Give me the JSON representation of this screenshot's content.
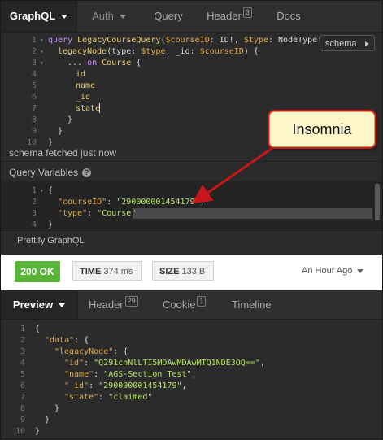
{
  "tabs": {
    "graphql": "GraphQL",
    "auth": "Auth",
    "query": "Query",
    "header": "Header",
    "header_count": "3",
    "docs": "Docs"
  },
  "editor": {
    "line_numbers": [
      "1",
      "2",
      "3",
      "4",
      "5",
      "6",
      "7",
      "8",
      "9",
      "10"
    ],
    "schema_button": "schema",
    "tokens": {
      "l1_kw": "query",
      "l1_name": "LegacyCourseQuery",
      "l1_p1": "(",
      "l1_v1": "$courseID",
      "l1_p2": ": ID!, ",
      "l1_v2": "$type",
      "l1_p3": ": NodeType!) {",
      "l2_field": "legacyNode",
      "l2_p1": "(type: ",
      "l2_v1": "$type",
      "l2_p2": ", _id: ",
      "l2_v2": "$courseID",
      "l2_p3": ") {",
      "l3_p1": "... ",
      "l3_kw": "on",
      "l3_type": " Course",
      "l3_p2": " {",
      "l4": "id",
      "l5": "name",
      "l6": "_id",
      "l7": "state",
      "l8": "}",
      "l9": "}",
      "l10": "}"
    }
  },
  "status_line": "schema fetched just now",
  "query_variables": {
    "label": "Query Variables",
    "line_numbers": [
      "1",
      "2",
      "3",
      "4"
    ],
    "l1": "{",
    "l2_key": "\"courseID\"",
    "l2_sep": ": ",
    "l2_val": "\"290000001454179\"",
    "l2_end": ",",
    "l3_key": "\"type\"",
    "l3_sep": ": ",
    "l3_val": "\"Course\"",
    "l4": "}"
  },
  "prettify": "Prettify GraphQL",
  "response_status": {
    "status": "200 OK",
    "time_label": "TIME",
    "time_value": "374 ms",
    "size_label": "SIZE",
    "size_value": "133 B",
    "when": "An Hour Ago"
  },
  "response_tabs": {
    "preview": "Preview",
    "header": "Header",
    "header_count": "29",
    "cookie": "Cookie",
    "cookie_count": "1",
    "timeline": "Timeline"
  },
  "response_body": {
    "line_numbers": [
      "1",
      "2",
      "3",
      "4",
      "5",
      "6",
      "7",
      "8",
      "9",
      "10"
    ],
    "l1": "{",
    "l2_key": "\"data\"",
    "l2_rest": ": {",
    "l3_key": "\"legacyNode\"",
    "l3_rest": ": {",
    "l4_key": "\"id\"",
    "l4_val": "\"Q291cnNlLTI5MDAwMDAwMTQ1NDE3OQ==\"",
    "l5_key": "\"name\"",
    "l5_val": "\"AGS-Section Test\"",
    "l6_key": "\"_id\"",
    "l6_val": "\"290000001454179\"",
    "l7_key": "\"state\"",
    "l7_val": "\"claimed\"",
    "l8": "}",
    "l9": "}",
    "l10": "}"
  },
  "callout": "Insomnia",
  "colors": {
    "ok_green": "#59b539",
    "callout_fill": "#fdf6c8",
    "callout_border": "#c8161b"
  }
}
